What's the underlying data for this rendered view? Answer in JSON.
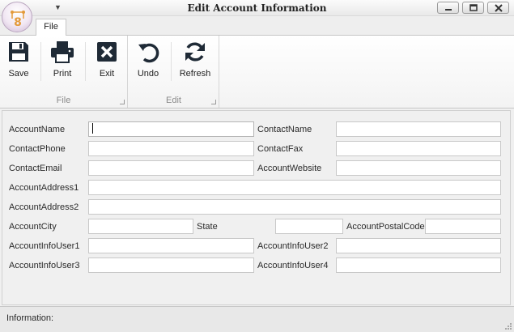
{
  "window": {
    "title": "Edit Account Information",
    "orb_text": "8"
  },
  "tabs": [
    {
      "label": "File"
    }
  ],
  "ribbon": {
    "groups": [
      {
        "label": "File"
      },
      {
        "label": "Edit"
      }
    ],
    "buttons": {
      "save": "Save",
      "print": "Print",
      "exit": "Exit",
      "undo": "Undo",
      "refresh": "Refresh"
    }
  },
  "form": {
    "account_name": {
      "label": "AccountName",
      "value": ""
    },
    "contact_name": {
      "label": "ContactName",
      "value": ""
    },
    "contact_phone": {
      "label": "ContactPhone",
      "value": ""
    },
    "contact_fax": {
      "label": "ContactFax",
      "value": ""
    },
    "contact_email": {
      "label": "ContactEmail",
      "value": ""
    },
    "account_website": {
      "label": "AccountWebsite",
      "value": ""
    },
    "account_address1": {
      "label": "AccountAddress1",
      "value": ""
    },
    "account_address2": {
      "label": "AccountAddress2",
      "value": ""
    },
    "account_city": {
      "label": "AccountCity",
      "value": ""
    },
    "state": {
      "label": "State",
      "value": ""
    },
    "account_postal_code": {
      "label": "AccountPostalCode",
      "value": ""
    },
    "account_info_user1": {
      "label": "AccountInfoUser1",
      "value": ""
    },
    "account_info_user2": {
      "label": "AccountInfoUser2",
      "value": ""
    },
    "account_info_user3": {
      "label": "AccountInfoUser3",
      "value": ""
    },
    "account_info_user4": {
      "label": "AccountInfoUser4",
      "value": ""
    }
  },
  "status": {
    "label": "Information:"
  },
  "colors": {
    "accent_orb": "#e39a3b",
    "ribbon_bg": "#f7f7f7",
    "form_bg": "#f0f0f0"
  }
}
